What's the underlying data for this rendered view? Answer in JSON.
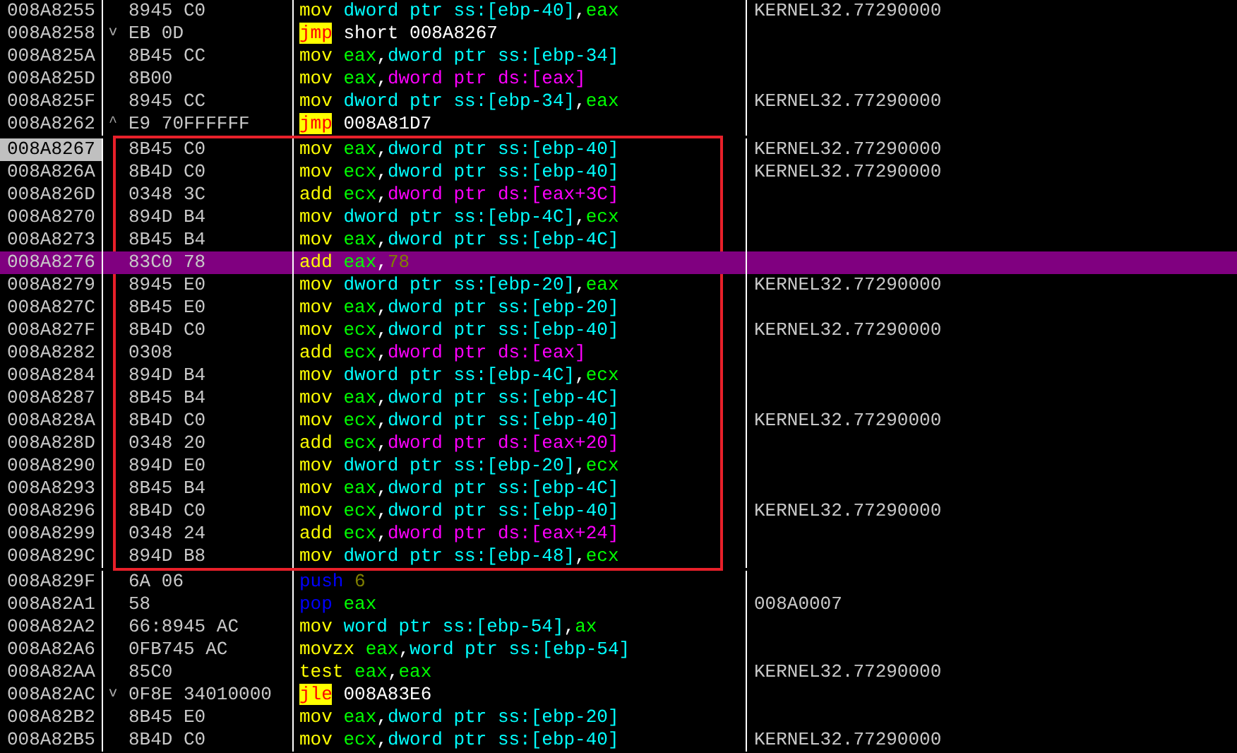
{
  "rows_above": [
    {
      "address": "008A8255",
      "bytes": "8945 C0",
      "instruction": [
        {
          "kind": "op",
          "text": "mov"
        },
        {
          "kind": "ss",
          "text": "dword ptr ss:[ebp-40]"
        },
        {
          "kind": "punct",
          "text": ","
        },
        {
          "kind": "reg",
          "text": "eax"
        }
      ],
      "comment": "KERNEL32.77290000",
      "current": false,
      "selected": false
    },
    {
      "address": "008A8258",
      "branch_mark": "v",
      "bytes": "EB 0D",
      "instruction": [
        {
          "kind": "jump",
          "text": "jmp"
        },
        {
          "kind": "addr",
          "text": "short 008A8267"
        }
      ],
      "current": false,
      "selected": false
    },
    {
      "address": "008A825A",
      "bytes": "8B45 CC",
      "instruction": [
        {
          "kind": "op",
          "text": "mov"
        },
        {
          "kind": "reg",
          "text": "eax"
        },
        {
          "kind": "punct",
          "text": ","
        },
        {
          "kind": "ss",
          "text": "dword ptr ss:[ebp-34]"
        }
      ],
      "current": false,
      "selected": false
    },
    {
      "address": "008A825D",
      "bytes": "8B00",
      "instruction": [
        {
          "kind": "op",
          "text": "mov"
        },
        {
          "kind": "reg",
          "text": "eax"
        },
        {
          "kind": "punct",
          "text": ","
        },
        {
          "kind": "ds",
          "text": "dword ptr ds:[eax]"
        }
      ],
      "current": false,
      "selected": false
    },
    {
      "address": "008A825F",
      "bytes": "8945 CC",
      "instruction": [
        {
          "kind": "op",
          "text": "mov"
        },
        {
          "kind": "ss",
          "text": "dword ptr ss:[ebp-34]"
        },
        {
          "kind": "punct",
          "text": ","
        },
        {
          "kind": "reg",
          "text": "eax"
        }
      ],
      "comment": "KERNEL32.77290000",
      "current": false,
      "selected": false
    },
    {
      "address": "008A8262",
      "branch_mark": "^",
      "bytes": "E9 70FFFFFF",
      "instruction": [
        {
          "kind": "jump",
          "text": "jmp"
        },
        {
          "kind": "addr",
          "text": "008A81D7"
        }
      ],
      "current": false,
      "selected": false
    }
  ],
  "boxed_rows": [
    {
      "address": "008A8267",
      "bytes": "8B45 C0",
      "instruction": [
        {
          "kind": "op",
          "text": "mov"
        },
        {
          "kind": "reg",
          "text": "eax"
        },
        {
          "kind": "punct",
          "text": ","
        },
        {
          "kind": "ss",
          "text": "dword ptr ss:[ebp-40]"
        }
      ],
      "comment": "KERNEL32.77290000",
      "current": true,
      "selected": false
    },
    {
      "address": "008A826A",
      "bytes": "8B4D C0",
      "instruction": [
        {
          "kind": "op",
          "text": "mov"
        },
        {
          "kind": "reg",
          "text": "ecx"
        },
        {
          "kind": "punct",
          "text": ","
        },
        {
          "kind": "ss",
          "text": "dword ptr ss:[ebp-40]"
        }
      ],
      "comment": "KERNEL32.77290000",
      "current": false,
      "selected": false
    },
    {
      "address": "008A826D",
      "bytes": "0348 3C",
      "instruction": [
        {
          "kind": "op",
          "text": "add"
        },
        {
          "kind": "reg",
          "text": "ecx"
        },
        {
          "kind": "punct",
          "text": ","
        },
        {
          "kind": "ds",
          "text": "dword ptr ds:[eax+3C]"
        }
      ],
      "current": false,
      "selected": false
    },
    {
      "address": "008A8270",
      "bytes": "894D B4",
      "instruction": [
        {
          "kind": "op",
          "text": "mov"
        },
        {
          "kind": "ss",
          "text": "dword ptr ss:[ebp-4C]"
        },
        {
          "kind": "punct",
          "text": ","
        },
        {
          "kind": "reg",
          "text": "ecx"
        }
      ],
      "current": false,
      "selected": false
    },
    {
      "address": "008A8273",
      "bytes": "8B45 B4",
      "instruction": [
        {
          "kind": "op",
          "text": "mov"
        },
        {
          "kind": "reg",
          "text": "eax"
        },
        {
          "kind": "punct",
          "text": ","
        },
        {
          "kind": "ss",
          "text": "dword ptr ss:[ebp-4C]"
        }
      ],
      "current": false,
      "selected": false
    },
    {
      "address": "008A8276",
      "bytes": "83C0 78",
      "instruction": [
        {
          "kind": "op",
          "text": "add"
        },
        {
          "kind": "reg",
          "text": "eax"
        },
        {
          "kind": "punct",
          "text": ","
        },
        {
          "kind": "imm",
          "text": "78"
        }
      ],
      "current": false,
      "selected": true
    },
    {
      "address": "008A8279",
      "bytes": "8945 E0",
      "instruction": [
        {
          "kind": "op",
          "text": "mov"
        },
        {
          "kind": "ss",
          "text": "dword ptr ss:[ebp-20]"
        },
        {
          "kind": "punct",
          "text": ","
        },
        {
          "kind": "reg",
          "text": "eax"
        }
      ],
      "comment": "KERNEL32.77290000",
      "current": false,
      "selected": false
    },
    {
      "address": "008A827C",
      "bytes": "8B45 E0",
      "instruction": [
        {
          "kind": "op",
          "text": "mov"
        },
        {
          "kind": "reg",
          "text": "eax"
        },
        {
          "kind": "punct",
          "text": ","
        },
        {
          "kind": "ss",
          "text": "dword ptr ss:[ebp-20]"
        }
      ],
      "current": false,
      "selected": false
    },
    {
      "address": "008A827F",
      "bytes": "8B4D C0",
      "instruction": [
        {
          "kind": "op",
          "text": "mov"
        },
        {
          "kind": "reg",
          "text": "ecx"
        },
        {
          "kind": "punct",
          "text": ","
        },
        {
          "kind": "ss",
          "text": "dword ptr ss:[ebp-40]"
        }
      ],
      "comment": "KERNEL32.77290000",
      "current": false,
      "selected": false
    },
    {
      "address": "008A8282",
      "bytes": "0308",
      "instruction": [
        {
          "kind": "op",
          "text": "add"
        },
        {
          "kind": "reg",
          "text": "ecx"
        },
        {
          "kind": "punct",
          "text": ","
        },
        {
          "kind": "ds",
          "text": "dword ptr ds:[eax]"
        }
      ],
      "current": false,
      "selected": false
    },
    {
      "address": "008A8284",
      "bytes": "894D B4",
      "instruction": [
        {
          "kind": "op",
          "text": "mov"
        },
        {
          "kind": "ss",
          "text": "dword ptr ss:[ebp-4C]"
        },
        {
          "kind": "punct",
          "text": ","
        },
        {
          "kind": "reg",
          "text": "ecx"
        }
      ],
      "current": false,
      "selected": false
    },
    {
      "address": "008A8287",
      "bytes": "8B45 B4",
      "instruction": [
        {
          "kind": "op",
          "text": "mov"
        },
        {
          "kind": "reg",
          "text": "eax"
        },
        {
          "kind": "punct",
          "text": ","
        },
        {
          "kind": "ss",
          "text": "dword ptr ss:[ebp-4C]"
        }
      ],
      "current": false,
      "selected": false
    },
    {
      "address": "008A828A",
      "bytes": "8B4D C0",
      "instruction": [
        {
          "kind": "op",
          "text": "mov"
        },
        {
          "kind": "reg",
          "text": "ecx"
        },
        {
          "kind": "punct",
          "text": ","
        },
        {
          "kind": "ss",
          "text": "dword ptr ss:[ebp-40]"
        }
      ],
      "comment": "KERNEL32.77290000",
      "current": false,
      "selected": false
    },
    {
      "address": "008A828D",
      "bytes": "0348 20",
      "instruction": [
        {
          "kind": "op",
          "text": "add"
        },
        {
          "kind": "reg",
          "text": "ecx"
        },
        {
          "kind": "punct",
          "text": ","
        },
        {
          "kind": "ds",
          "text": "dword ptr ds:[eax+20]"
        }
      ],
      "current": false,
      "selected": false
    },
    {
      "address": "008A8290",
      "bytes": "894D E0",
      "instruction": [
        {
          "kind": "op",
          "text": "mov"
        },
        {
          "kind": "ss",
          "text": "dword ptr ss:[ebp-20]"
        },
        {
          "kind": "punct",
          "text": ","
        },
        {
          "kind": "reg",
          "text": "ecx"
        }
      ],
      "current": false,
      "selected": false
    },
    {
      "address": "008A8293",
      "bytes": "8B45 B4",
      "instruction": [
        {
          "kind": "op",
          "text": "mov"
        },
        {
          "kind": "reg",
          "text": "eax"
        },
        {
          "kind": "punct",
          "text": ","
        },
        {
          "kind": "ss",
          "text": "dword ptr ss:[ebp-4C]"
        }
      ],
      "current": false,
      "selected": false
    },
    {
      "address": "008A8296",
      "bytes": "8B4D C0",
      "instruction": [
        {
          "kind": "op",
          "text": "mov"
        },
        {
          "kind": "reg",
          "text": "ecx"
        },
        {
          "kind": "punct",
          "text": ","
        },
        {
          "kind": "ss",
          "text": "dword ptr ss:[ebp-40]"
        }
      ],
      "comment": "KERNEL32.77290000",
      "current": false,
      "selected": false
    },
    {
      "address": "008A8299",
      "bytes": "0348 24",
      "instruction": [
        {
          "kind": "op",
          "text": "add"
        },
        {
          "kind": "reg",
          "text": "ecx"
        },
        {
          "kind": "punct",
          "text": ","
        },
        {
          "kind": "ds",
          "text": "dword ptr ds:[eax+24]"
        }
      ],
      "current": false,
      "selected": false
    },
    {
      "address": "008A829C",
      "bytes": "894D B8",
      "instruction": [
        {
          "kind": "op",
          "text": "mov"
        },
        {
          "kind": "ss",
          "text": "dword ptr ss:[ebp-48]"
        },
        {
          "kind": "punct",
          "text": ","
        },
        {
          "kind": "reg",
          "text": "ecx"
        }
      ],
      "current": false,
      "selected": false
    }
  ],
  "rows_below": [
    {
      "address": "008A829F",
      "bytes": "6A 06",
      "instruction": [
        {
          "kind": "stack",
          "text": "push"
        },
        {
          "kind": "imm",
          "text": "6"
        }
      ],
      "current": false,
      "selected": false
    },
    {
      "address": "008A82A1",
      "bytes": "58",
      "instruction": [
        {
          "kind": "stack",
          "text": "pop"
        },
        {
          "kind": "reg",
          "text": "eax"
        }
      ],
      "comment": "008A0007",
      "current": false,
      "selected": false
    },
    {
      "address": "008A82A2",
      "bytes": "66:8945 AC",
      "instruction": [
        {
          "kind": "op",
          "text": "mov"
        },
        {
          "kind": "ss",
          "text": "word ptr ss:[ebp-54]"
        },
        {
          "kind": "punct",
          "text": ","
        },
        {
          "kind": "reg",
          "text": "ax"
        }
      ],
      "current": false,
      "selected": false
    },
    {
      "address": "008A82A6",
      "bytes": "0FB745 AC",
      "instruction": [
        {
          "kind": "op",
          "text": "movzx"
        },
        {
          "kind": "reg",
          "text": "eax"
        },
        {
          "kind": "punct",
          "text": ","
        },
        {
          "kind": "ss",
          "text": "word ptr ss:[ebp-54]"
        }
      ],
      "current": false,
      "selected": false
    },
    {
      "address": "008A82AA",
      "bytes": "85C0",
      "instruction": [
        {
          "kind": "op",
          "text": "test"
        },
        {
          "kind": "reg",
          "text": "eax"
        },
        {
          "kind": "punct",
          "text": ","
        },
        {
          "kind": "reg",
          "text": "eax"
        }
      ],
      "comment": "KERNEL32.77290000",
      "current": false,
      "selected": false
    },
    {
      "address": "008A82AC",
      "branch_mark": "v",
      "bytes": "0F8E 34010000",
      "instruction": [
        {
          "kind": "jump",
          "text": "jle"
        },
        {
          "kind": "addr",
          "text": "008A83E6"
        }
      ],
      "current": false,
      "selected": false
    },
    {
      "address": "008A82B2",
      "bytes": "8B45 E0",
      "instruction": [
        {
          "kind": "op",
          "text": "mov"
        },
        {
          "kind": "reg",
          "text": "eax"
        },
        {
          "kind": "punct",
          "text": ","
        },
        {
          "kind": "ss",
          "text": "dword ptr ss:[ebp-20]"
        }
      ],
      "current": false,
      "selected": false
    },
    {
      "address": "008A82B5",
      "bytes": "8B4D C0",
      "instruction": [
        {
          "kind": "op",
          "text": "mov"
        },
        {
          "kind": "reg",
          "text": "ecx"
        },
        {
          "kind": "punct",
          "text": ","
        },
        {
          "kind": "ss",
          "text": "dword ptr ss:[ebp-40]"
        }
      ],
      "comment": "KERNEL32.77290000",
      "current": false,
      "selected": false
    }
  ]
}
